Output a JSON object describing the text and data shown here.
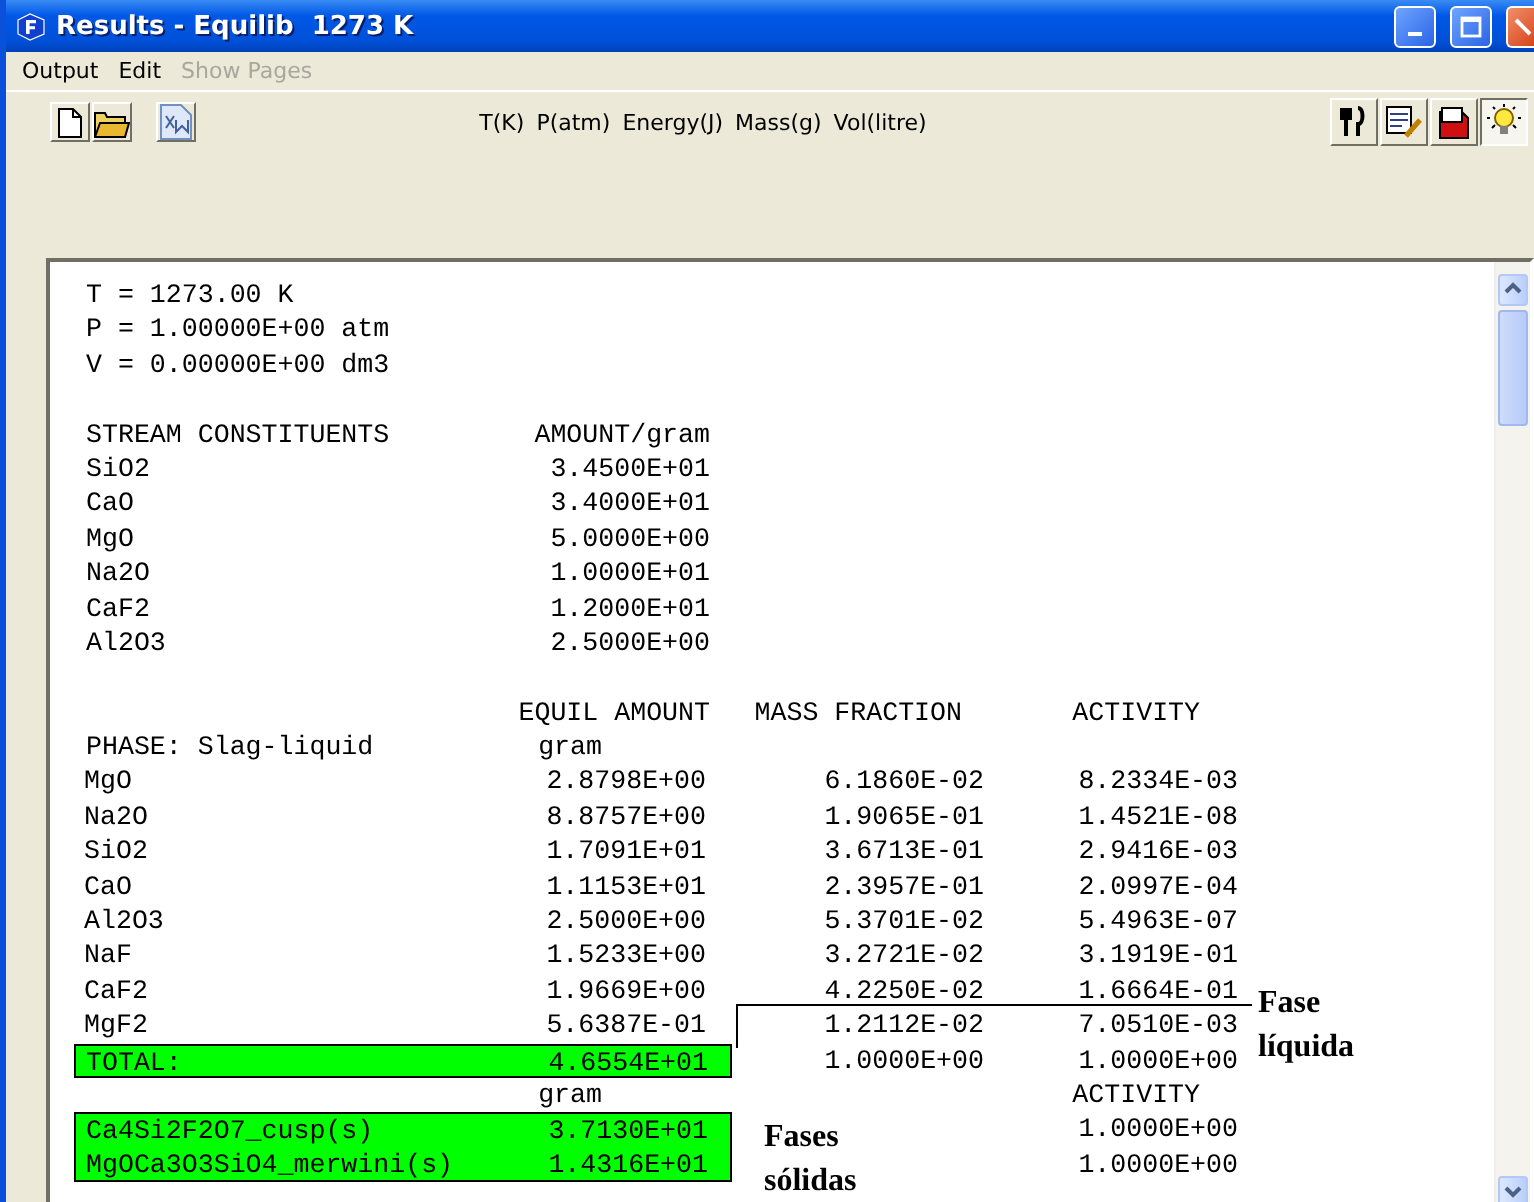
{
  "window": {
    "title": "Results - Equilib  1273 K"
  },
  "menu": [
    {
      "label": "Output",
      "disabled": false
    },
    {
      "label": "Edit",
      "disabled": false
    },
    {
      "label": "Show Pages",
      "disabled": true
    }
  ],
  "toolbar": {
    "left_tools": [
      {
        "kind": "new"
      },
      {
        "kind": "open"
      },
      {
        "kind": "xml"
      }
    ],
    "units": [
      "T(K)",
      "P(atm)",
      "Energy(J)",
      "Mass(g)",
      "Vol(litre)"
    ],
    "right_tools": [
      {
        "kind": "utensils",
        "pressed": false
      },
      {
        "kind": "notepad",
        "pressed": false
      },
      {
        "kind": "book",
        "pressed": false
      },
      {
        "kind": "bulb",
        "pressed": true
      }
    ]
  },
  "report": {
    "conditions": [
      "T = 1273.00 K",
      "P = 1.00000E+00 atm",
      "V = 0.00000E+00 dm3"
    ],
    "stream": {
      "columns": [
        "STREAM CONSTITUENTS",
        "AMOUNT/gram"
      ],
      "rows": [
        [
          "SiO2",
          "3.4500E+01"
        ],
        [
          "CaO",
          "3.4000E+01"
        ],
        [
          "MgO",
          "5.0000E+00"
        ],
        [
          "Na2O",
          "1.0000E+01"
        ],
        [
          "CaF2",
          "1.2000E+01"
        ],
        [
          "Al2O3",
          "2.5000E+00"
        ]
      ]
    },
    "phase": {
      "title": "PHASE: Slag-liquid",
      "columns": [
        "EQUIL AMOUNT",
        "MASS FRACTION",
        "ACTIVITY"
      ],
      "unit": "gram",
      "rows": [
        {
          "name": "MgO",
          "amount": "2.8798E+00",
          "mass_fraction": "6.1860E-02",
          "activity": "8.2334E-03",
          "highlighted": false
        },
        {
          "name": "Na2O",
          "amount": "8.8757E+00",
          "mass_fraction": "1.9065E-01",
          "activity": "1.4521E-08",
          "highlighted": false
        },
        {
          "name": "SiO2",
          "amount": "1.7091E+01",
          "mass_fraction": "3.6713E-01",
          "activity": "2.9416E-03",
          "highlighted": false
        },
        {
          "name": "CaO",
          "amount": "1.1153E+01",
          "mass_fraction": "2.3957E-01",
          "activity": "2.0997E-04",
          "highlighted": false
        },
        {
          "name": "Al2O3",
          "amount": "2.5000E+00",
          "mass_fraction": "5.3701E-02",
          "activity": "5.4963E-07",
          "highlighted": false
        },
        {
          "name": "NaF",
          "amount": "1.5233E+00",
          "mass_fraction": "3.2721E-02",
          "activity": "3.1919E-01",
          "highlighted": false
        },
        {
          "name": "CaF2",
          "amount": "1.9669E+00",
          "mass_fraction": "4.2250E-02",
          "activity": "1.6664E-01",
          "highlighted": false
        },
        {
          "name": "MgF2",
          "amount": "5.6387E-01",
          "mass_fraction": "1.2112E-02",
          "activity": "7.0510E-03",
          "highlighted": false
        },
        {
          "name": "TOTAL:",
          "amount": "4.6554E+01",
          "mass_fraction": "1.0000E+00",
          "activity": "1.0000E+00",
          "highlighted": true
        }
      ]
    },
    "solids": {
      "unit": "gram",
      "activity_header": "ACTIVITY",
      "rows": [
        {
          "name": "Ca4Si2F2O7_cusp(s)",
          "amount": "3.7130E+01",
          "activity": "1.0000E+00",
          "highlighted": true
        },
        {
          "name": "MgOCa3O3SiO4_merwini(s)",
          "amount": "1.4316E+01",
          "activity": "1.0000E+00",
          "highlighted": true
        }
      ]
    }
  },
  "annotations": [
    {
      "text": "Fase líquida",
      "kind": "liquid"
    },
    {
      "text": "Fases sólidas",
      "kind": "solid"
    }
  ]
}
